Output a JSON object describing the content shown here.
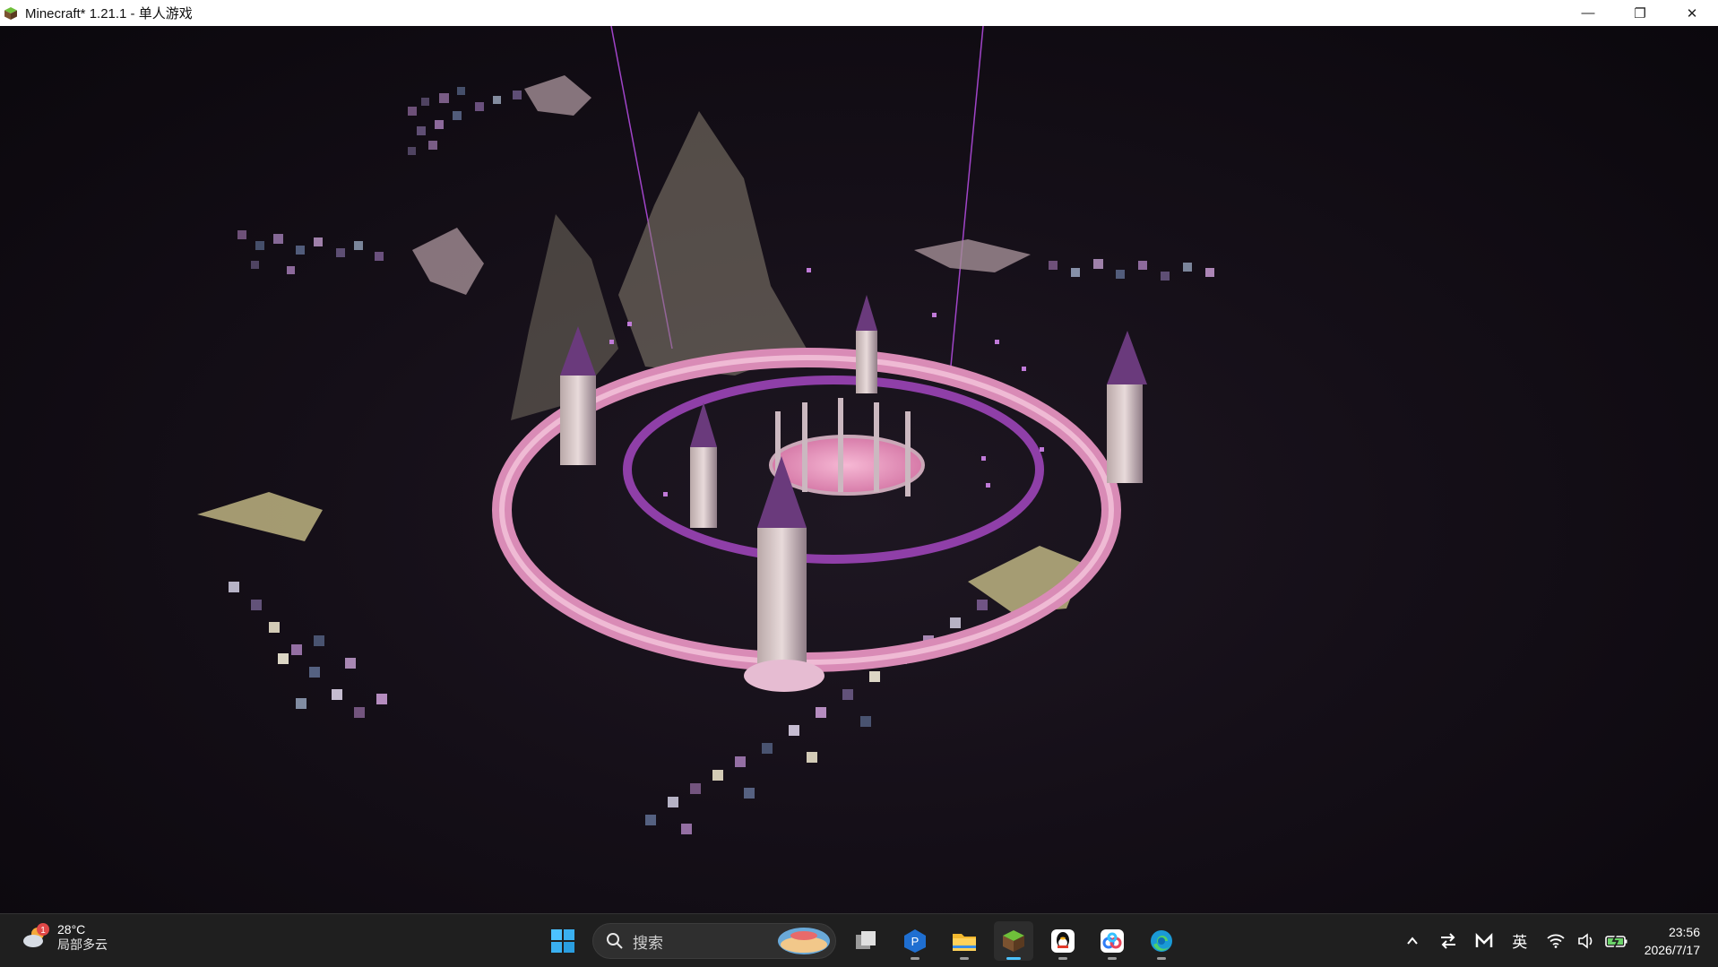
{
  "window": {
    "title": "Minecraft* 1.21.1 - 单人游戏",
    "minimize_glyph": "—",
    "restore_glyph": "❐",
    "close_glyph": "✕"
  },
  "taskbar": {
    "weather": {
      "badge": "1",
      "temperature": "28°C",
      "condition": "局部多云"
    },
    "search": {
      "placeholder": "搜索"
    },
    "pinned": [
      "windows-start",
      "task-view",
      "powershell",
      "file-explorer",
      "minecraft",
      "qq",
      "baidu-netdisk",
      "edge"
    ],
    "tray": {
      "ime": "英"
    },
    "clock": {
      "time": "23:56",
      "date": "2026/7/17"
    }
  }
}
